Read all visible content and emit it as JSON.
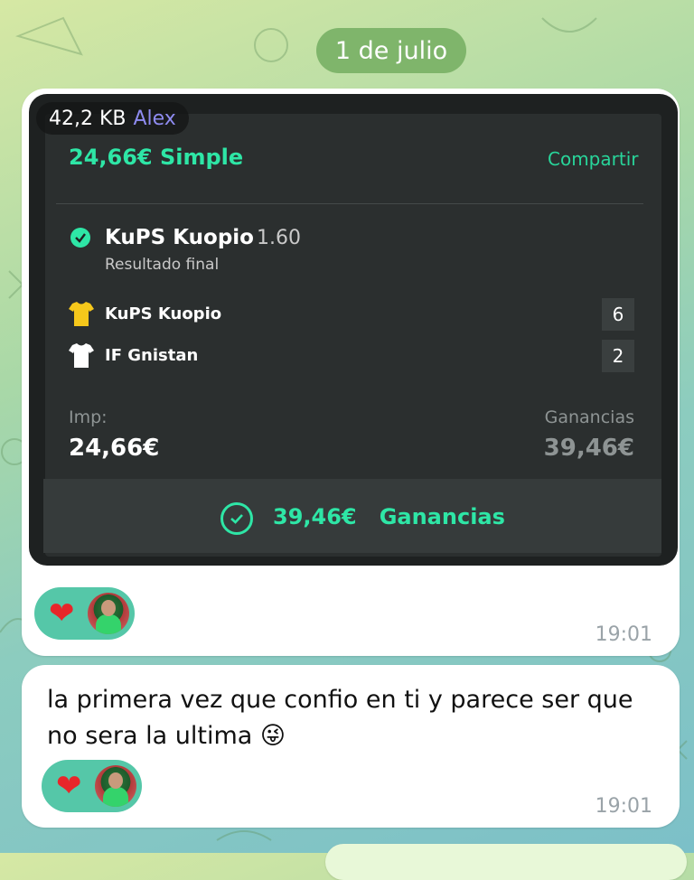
{
  "date_divider": "1 de julio",
  "message1": {
    "file_size": "42,2 KB",
    "sender": "Alex",
    "bet_card": {
      "title": "24,66€ Simple",
      "share_label": "Compartir",
      "selection_name": "KuPS Kuopio",
      "selection_odds": "1.60",
      "selection_type": "Resultado final",
      "teams": [
        {
          "name": "KuPS Kuopio",
          "score": "6",
          "shirt_color": "#f6c81b"
        },
        {
          "name": "IF Gnistan",
          "score": "2",
          "shirt_color": "#ffffff"
        }
      ],
      "stake_label": "Imp:",
      "stake_value": "24,66€",
      "winnings_label": "Ganancias",
      "winnings_value": "39,46€",
      "result_amount": "39,46€",
      "result_label": "Ganancias"
    },
    "reaction_emoji": "❤",
    "time": "19:01"
  },
  "message2": {
    "text": "la primera vez que confio en ti y parece ser que no sera la ultima",
    "emoji": "😜",
    "reaction_emoji": "❤",
    "time": "19:01"
  },
  "colors": {
    "accent_green": "#2ee6a6",
    "reaction_bg": "#55c7a8",
    "date_pill": "#7fb56b"
  }
}
